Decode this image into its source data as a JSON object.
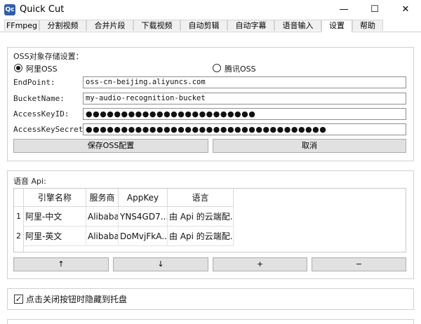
{
  "window": {
    "icon_text": "Qc",
    "title": "Quick Cut",
    "minimize": "—",
    "maximize": "☐",
    "close": "✕"
  },
  "tabs": [
    {
      "label": "FFmpeg"
    },
    {
      "label": "分割视频"
    },
    {
      "label": "合并片段"
    },
    {
      "label": "下载视频"
    },
    {
      "label": "自动剪辑"
    },
    {
      "label": "自动字幕"
    },
    {
      "label": "语音输入"
    },
    {
      "label": "设置"
    },
    {
      "label": "帮助"
    }
  ],
  "oss": {
    "title": "OSS对象存储设置：",
    "provider_aliyun": "阿里OSS",
    "provider_tencent": "腾讯OSS",
    "selected_provider": "阿里OSS",
    "endpoint_label": "EndPoint:",
    "endpoint_value": "oss-cn-beijing.aliyuncs.com",
    "bucket_label": "BucketName:",
    "bucket_value": "my-audio-recognition-bucket",
    "keyid_label": "AccessKeyID:",
    "keyid_value": "●●●●●●●●●●●●●●●●●●●●●●●●",
    "secret_label": "AccessKeySecret:",
    "secret_value": "●●●●●●●●●●●●●●●●●●●●●●●●●●●●●●●●●●",
    "save_button": "保存OSS配置",
    "cancel_button": "取消"
  },
  "api": {
    "title": "语音 Api:",
    "columns": [
      "引擎名称",
      "服务商",
      "AppKey",
      "语言"
    ],
    "rows": [
      {
        "num": "1",
        "name": "阿里-中文",
        "provider": "Alibaba",
        "appkey": "YNS4GD7...",
        "lang": "由 Api 的云端配..."
      },
      {
        "num": "2",
        "name": "阿里-英文",
        "provider": "Alibaba",
        "appkey": "DoMvjFkA...",
        "lang": "由 Api 的云端配..."
      }
    ],
    "up_button": "↑",
    "down_button": "↓",
    "add_button": "+",
    "remove_button": "−"
  },
  "tray": {
    "checked": true,
    "check_mark": "✓",
    "label": "点击关闭按钮时隐藏到托盘"
  }
}
